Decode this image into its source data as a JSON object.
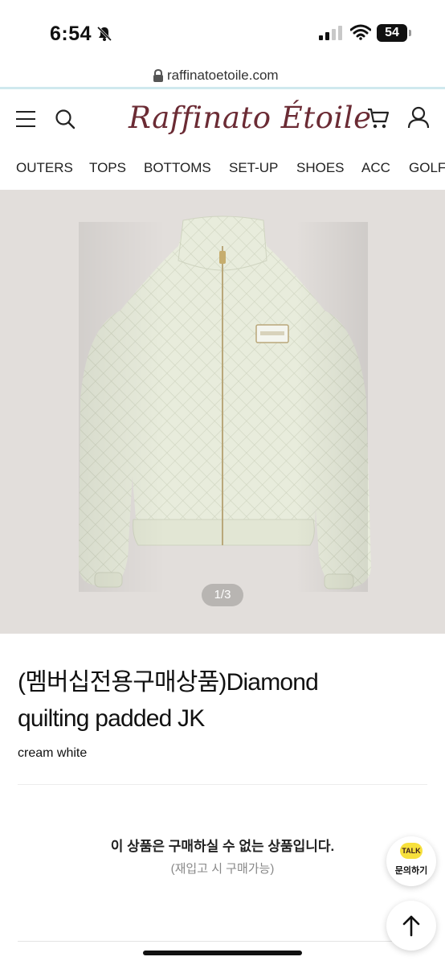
{
  "status_bar": {
    "time": "6:54",
    "battery": "54"
  },
  "browser": {
    "url": "raffinatoetoile.com"
  },
  "header": {
    "logo_text": "Raffinato Étoile"
  },
  "categories": [
    "OUTERS",
    "TOPS",
    "BOTTOMS",
    "SET-UP",
    "SHOES",
    "ACC",
    "GOLF"
  ],
  "gallery": {
    "pager": "1/3"
  },
  "product": {
    "title_line1": "(멤버십전용구매상품)Diamond",
    "title_line2": "quilting padded JK",
    "color_option": "cream white",
    "unavailable_message": "이 상품은 구매하실 수 없는 상품입니다.",
    "restock_note": "(재입고 시 구매가능)"
  },
  "floating": {
    "talk_badge": "TALK",
    "talk_label": "문의하기"
  },
  "colors": {
    "brand": "#6b2b34",
    "accent_line": "#cfe9ee",
    "hero_bg": "#e2dedb",
    "jacket": "#e8ecdc"
  }
}
